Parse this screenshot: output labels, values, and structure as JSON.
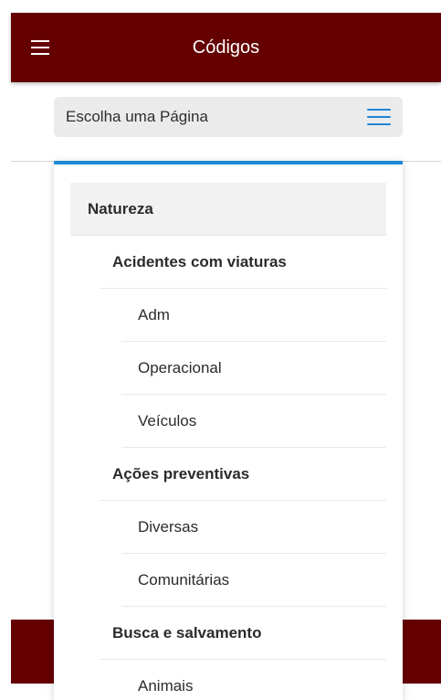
{
  "appbar": {
    "title": "Códigos",
    "menu_icon": "hamburger-menu-icon",
    "background_color": "#640000"
  },
  "select": {
    "label": "Escolha uma Página",
    "icon": "list-menu-icon",
    "icon_color": "#1e88d6"
  },
  "dropdown": {
    "accent_color": "#1e88d6",
    "items": [
      {
        "label": "Natureza",
        "level": 0,
        "selected": true
      },
      {
        "label": "Acidentes com viaturas",
        "level": 1
      },
      {
        "label": "Adm",
        "level": 2
      },
      {
        "label": "Operacional",
        "level": 2
      },
      {
        "label": "Veículos",
        "level": 2
      },
      {
        "label": "Ações preventivas",
        "level": 1
      },
      {
        "label": "Diversas",
        "level": 2
      },
      {
        "label": "Comunitárias",
        "level": 2
      },
      {
        "label": "Busca e salvamento",
        "level": 1
      },
      {
        "label": "Animais",
        "level": 2
      }
    ]
  }
}
